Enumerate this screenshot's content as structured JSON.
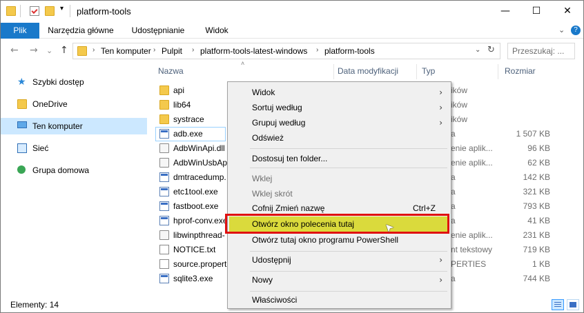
{
  "window": {
    "title": "platform-tools"
  },
  "titlebar": {
    "minimize": "—",
    "maximize": "☐",
    "close": "✕"
  },
  "ribbon": {
    "tabs": [
      {
        "label": "Plik"
      },
      {
        "label": "Narzędzia główne"
      },
      {
        "label": "Udostępnianie"
      },
      {
        "label": "Widok"
      }
    ],
    "help": "?"
  },
  "nav": {
    "back": "←",
    "forward": "→",
    "recent": "⌄",
    "up": "↑",
    "breadcrumb": [
      "Ten komputer",
      "Pulpit",
      "platform-tools-latest-windows",
      "platform-tools"
    ],
    "refresh": "↻",
    "search_placeholder": "Przeszukaj: ..."
  },
  "sidebar": {
    "items": [
      {
        "label": "Szybki dostęp",
        "icon": "star-icon"
      },
      {
        "label": "OneDrive",
        "icon": "folder-icon"
      },
      {
        "label": "Ten komputer",
        "icon": "computer-icon",
        "selected": true
      },
      {
        "label": "Sieć",
        "icon": "network-icon"
      },
      {
        "label": "Grupa domowa",
        "icon": "homegroup-icon"
      }
    ]
  },
  "columns": {
    "name": "Nazwa",
    "modified": "Data modyfikacji",
    "type": "Typ",
    "size": "Rozmiar"
  },
  "files": [
    {
      "name": "api",
      "kind": "folder",
      "type": "ików",
      "size": ""
    },
    {
      "name": "lib64",
      "kind": "folder",
      "type": "ików",
      "size": ""
    },
    {
      "name": "systrace",
      "kind": "folder",
      "type": "ików",
      "size": ""
    },
    {
      "name": "adb.exe",
      "kind": "exe",
      "type": "a",
      "size": "1 507 KB"
    },
    {
      "name": "AdbWinApi.dll",
      "kind": "dll",
      "type": "enie aplik...",
      "size": "96 KB"
    },
    {
      "name": "AdbWinUsbApi",
      "kind": "dll",
      "type": "enie aplik...",
      "size": "62 KB"
    },
    {
      "name": "dmtracedump.",
      "kind": "exe",
      "type": "a",
      "size": "142 KB"
    },
    {
      "name": "etc1tool.exe",
      "kind": "exe",
      "type": "a",
      "size": "321 KB"
    },
    {
      "name": "fastboot.exe",
      "kind": "exe",
      "type": "a",
      "size": "793 KB"
    },
    {
      "name": "hprof-conv.exe",
      "kind": "exe",
      "type": "a",
      "size": "41 KB"
    },
    {
      "name": "libwinpthread-",
      "kind": "dll",
      "type": "enie aplik...",
      "size": "231 KB"
    },
    {
      "name": "NOTICE.txt",
      "kind": "txt",
      "type": "nt tekstowy",
      "size": "719 KB"
    },
    {
      "name": "source.properti",
      "kind": "txt",
      "type": "PERTIES",
      "size": "1 KB"
    },
    {
      "name": "sqlite3.exe",
      "kind": "exe",
      "type": "a",
      "size": "744 KB"
    }
  ],
  "status": {
    "count": "Elementy: 14"
  },
  "context_menu": {
    "items": [
      {
        "label": "Widok",
        "submenu": "›"
      },
      {
        "label": "Sortuj według",
        "submenu": "›"
      },
      {
        "label": "Grupuj według",
        "submenu": "›"
      },
      {
        "label": "Odśwież"
      },
      {
        "separator": true
      },
      {
        "label": "Dostosuj ten folder..."
      },
      {
        "separator": true
      },
      {
        "label": "Wklej",
        "disabled": true
      },
      {
        "label": "Wklej skrót",
        "disabled": true
      },
      {
        "label": "Cofnij Zmień nazwę",
        "shortcut": "Ctrl+Z"
      },
      {
        "label": "Otwórz okno polecenia tutaj",
        "highlighted": true
      },
      {
        "label": "Otwórz tutaj okno programu PowerShell"
      },
      {
        "separator": true
      },
      {
        "label": "Udostępnij",
        "submenu": "›"
      },
      {
        "separator": true
      },
      {
        "label": "Nowy",
        "submenu": "›"
      },
      {
        "separator": true
      },
      {
        "label": "Właściwości"
      }
    ]
  },
  "colors": {
    "accent": "#1979ca",
    "selection": "#cce8ff",
    "highlight": "#dada3c",
    "annotation": "#e01010"
  }
}
